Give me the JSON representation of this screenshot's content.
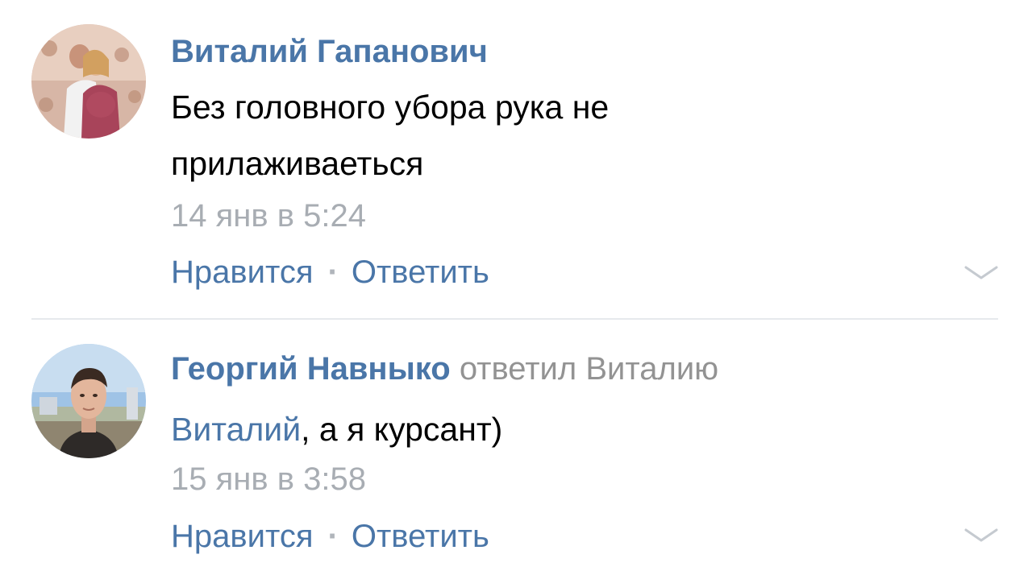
{
  "colors": {
    "link": "#4a76a8",
    "muted": "#a8adb3",
    "reply_muted": "#939393",
    "divider": "#e6e9ed"
  },
  "comments": [
    {
      "author": "Виталий Гапанович",
      "reply_to": "",
      "mention": "",
      "text_lines": [
        "Без головного убора рука не",
        "прилаживаеться"
      ],
      "timestamp": "14 янв в 5:24",
      "like_label": "Нравится",
      "separator": "·",
      "reply_label": "Ответить",
      "menu_icon": "chevron-down-icon"
    },
    {
      "author": "Георгий Навныко",
      "reply_to": "ответил Виталию",
      "mention": "Виталий",
      "text_rest": ", а я курсант)",
      "timestamp": "15 янв в 3:58",
      "like_label": "Нравится",
      "separator": "·",
      "reply_label": "Ответить",
      "menu_icon": "chevron-down-icon"
    }
  ]
}
